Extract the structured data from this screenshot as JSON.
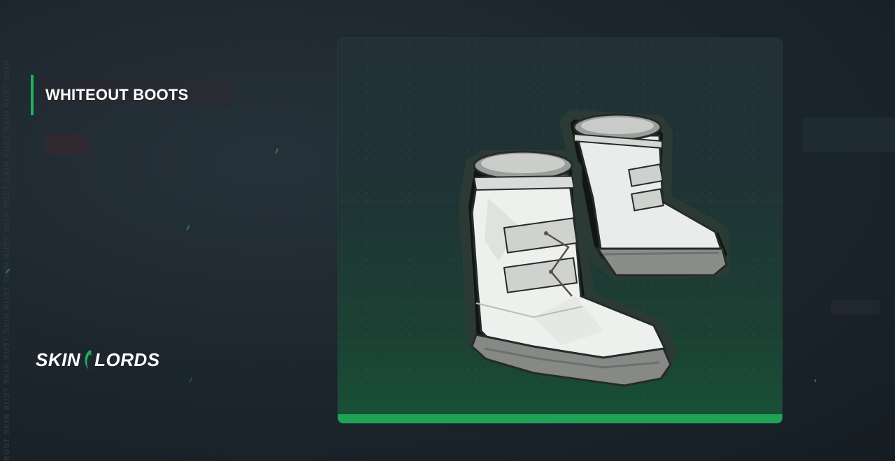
{
  "item": {
    "title": "WHITEOUT BOOTS"
  },
  "brand": {
    "logo_left": "SKIN",
    "logo_right": "LORDS"
  },
  "watermark": {
    "text": "RUST SKIN RUST SKIN RUST SKIN RUST SKIN RUST SKIN RUST SKIN RUST SKIN RUST SKIN"
  },
  "colors": {
    "accent": "#1db35a",
    "background": "#1d272f",
    "card_bar": "#1fa356"
  },
  "icons": {
    "logo_mark": "green-crescent-mark"
  }
}
